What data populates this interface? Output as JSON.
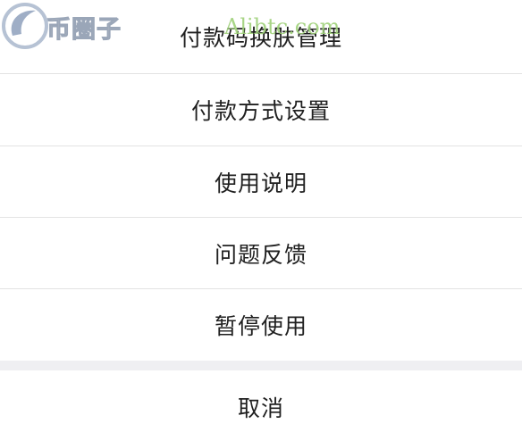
{
  "watermark": {
    "logo_text": "币圈子",
    "url_text": "Alibtc.com"
  },
  "menu": {
    "items": [
      {
        "label": "付款码换肤管理"
      },
      {
        "label": "付款方式设置"
      },
      {
        "label": "使用说明"
      },
      {
        "label": "问题反馈"
      },
      {
        "label": "暂停使用"
      }
    ],
    "cancel_label": "取消"
  },
  "colors": {
    "text": "#1f1f1f",
    "divider": "#e3e3e3",
    "gap": "#efeff2",
    "background": "#ffffff"
  }
}
